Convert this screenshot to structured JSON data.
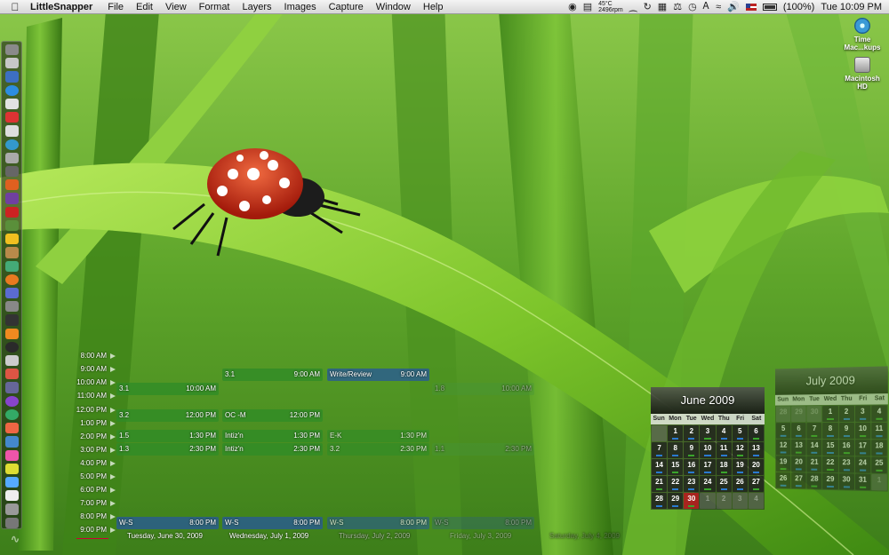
{
  "menubar": {
    "app_name": "LittleSnapper",
    "menus": [
      "File",
      "Edit",
      "View",
      "Format",
      "Layers",
      "Images",
      "Capture",
      "Window",
      "Help"
    ],
    "cpu_temp": "45°C",
    "fan_speed": "2496rpm",
    "battery": "(100%)",
    "clock": "Tue 10:09 PM"
  },
  "desktop_icons": {
    "time_machine": "Time Mac...kups",
    "hard_disk": "Macintosh HD"
  },
  "day_view": {
    "times": [
      "8:00 AM",
      "9:00 AM",
      "10:00 AM",
      "11:00 AM",
      "12:00 PM",
      "1:00 PM",
      "2:00 PM",
      "3:00 PM",
      "4:00 PM",
      "5:00 PM",
      "6:00 PM",
      "7:00 PM",
      "8:00 PM",
      "9:00 PM"
    ],
    "days": [
      "Tuesday, June 30, 2009",
      "Wednesday, July 1, 2009",
      "Thursday, July 2, 2009",
      "Friday, July 3, 2009",
      "Saturday, July 4, 2009"
    ],
    "events": {
      "d1_a": {
        "title": "3.1",
        "time": "10:00 AM"
      },
      "d1_b": {
        "title": "3.2",
        "time": "12:00 PM"
      },
      "d1_c": {
        "title": "1.5",
        "time": "1:30 PM"
      },
      "d1_d": {
        "title": "1.3",
        "time": "2:30 PM"
      },
      "d1_e": {
        "title": "W-S",
        "time": "8:00 PM"
      },
      "d2_a": {
        "title": "3.1",
        "time": "9:00 AM"
      },
      "d2_b": {
        "title": "OC -M",
        "time": "12:00 PM"
      },
      "d2_c": {
        "title": "Intiz'n",
        "time": "1:30 PM"
      },
      "d2_d": {
        "title": "Intiz'n",
        "time": "2:30 PM"
      },
      "d2_e": {
        "title": "W-S",
        "time": "8:00 PM"
      },
      "d3_a": {
        "title": "Write/Review",
        "time": "9:00 AM"
      },
      "d3_b": {
        "title": "E-K",
        "time": "1:30 PM"
      },
      "d3_c": {
        "title": "3.2",
        "time": "2:30 PM"
      },
      "d3_d": {
        "title": "W-S",
        "time": "8:00 PM"
      },
      "d4_a": {
        "title": "1.8",
        "time": "10:00 AM"
      },
      "d4_b": {
        "title": "1.1",
        "time": "2:30 PM"
      },
      "d4_c": {
        "title": "W-S",
        "time": "8:00 PM"
      }
    }
  },
  "mini_calendars": {
    "june": {
      "title": "June 2009",
      "dow": [
        "Sun",
        "Mon",
        "Tue",
        "Wed",
        "Thu",
        "Fri",
        "Sat"
      ],
      "cells": [
        "",
        "1",
        "2",
        "3",
        "4",
        "5",
        "6",
        "7",
        "8",
        "9",
        "10",
        "11",
        "12",
        "13",
        "14",
        "15",
        "16",
        "17",
        "18",
        "19",
        "20",
        "21",
        "22",
        "23",
        "24",
        "25",
        "26",
        "27",
        "28",
        "29",
        "30",
        "1",
        "2",
        "3",
        "4"
      ]
    },
    "july": {
      "title": "July 2009",
      "dow": [
        "Sun",
        "Mon",
        "Tue",
        "Wed",
        "Thu",
        "Fri",
        "Sat"
      ],
      "cells": [
        "28",
        "29",
        "30",
        "1",
        "2",
        "3",
        "4",
        "5",
        "6",
        "7",
        "8",
        "9",
        "10",
        "11",
        "12",
        "13",
        "14",
        "15",
        "16",
        "17",
        "18",
        "19",
        "20",
        "21",
        "22",
        "23",
        "24",
        "25",
        "26",
        "27",
        "28",
        "29",
        "30",
        "31",
        "1"
      ]
    }
  }
}
